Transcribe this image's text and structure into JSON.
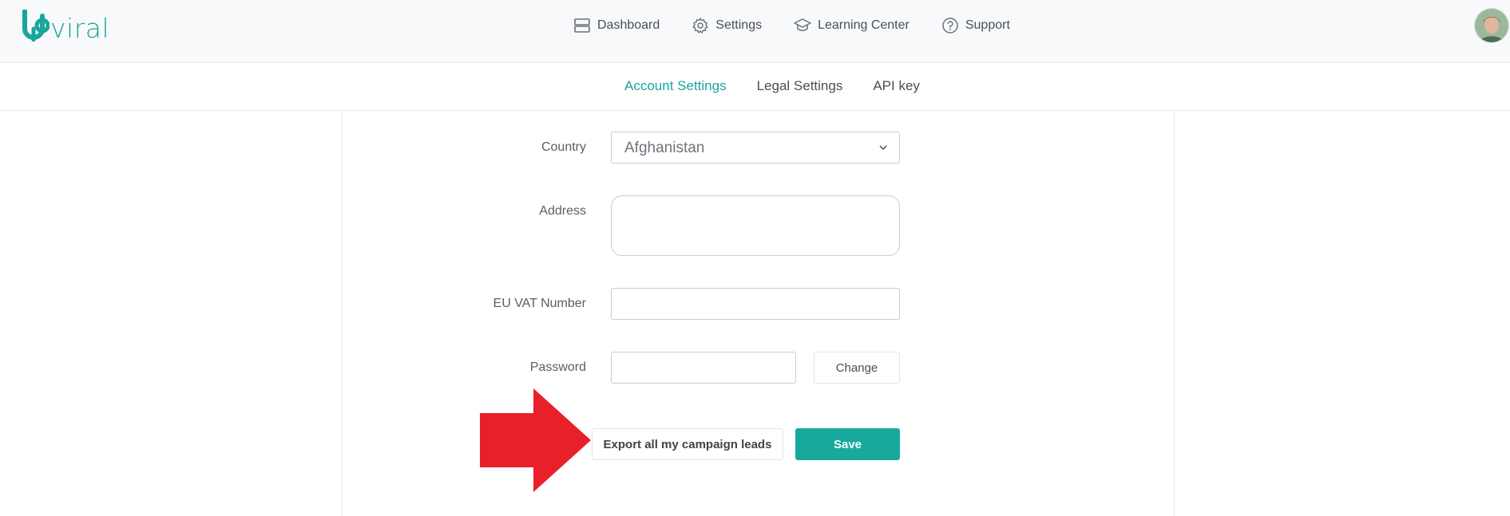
{
  "brand": {
    "name": "viral",
    "accent": "#1aa59c"
  },
  "nav": [
    {
      "label": "Dashboard",
      "icon": "dashboard-icon"
    },
    {
      "label": "Settings",
      "icon": "gear-icon"
    },
    {
      "label": "Learning Center",
      "icon": "graduation-cap-icon"
    },
    {
      "label": "Support",
      "icon": "help-circle-icon"
    }
  ],
  "subtabs": [
    {
      "label": "Account Settings",
      "active": true
    },
    {
      "label": "Legal Settings",
      "active": false
    },
    {
      "label": "API key",
      "active": false
    }
  ],
  "form": {
    "country": {
      "label": "Country",
      "value": "Afghanistan"
    },
    "address": {
      "label": "Address",
      "value": ""
    },
    "vat": {
      "label": "EU VAT Number",
      "value": ""
    },
    "password": {
      "label": "Password",
      "value": ""
    },
    "change_label": "Change",
    "export_label": "Export all my campaign leads",
    "save_label": "Save"
  },
  "annotation": {
    "shape": "arrow-right-icon",
    "color": "#e8202a"
  },
  "colors": {
    "primary_button": "#17a99d",
    "active_tab": "#1aa59c"
  }
}
